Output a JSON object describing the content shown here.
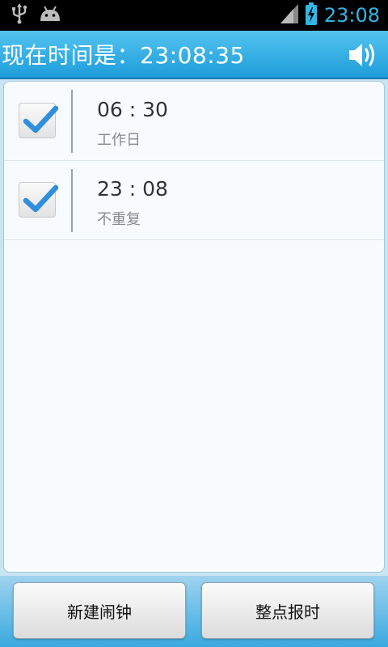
{
  "status_bar": {
    "time": "23:08",
    "time_color": "#33b5e5",
    "icons": [
      "usb-icon",
      "android-debug-icon",
      "signal-icon",
      "battery-charging-icon"
    ]
  },
  "header": {
    "title": "现在时间是：23:08:35",
    "sound_icon": "speaker-icon",
    "bg_color": "#2aa6de"
  },
  "alarms": [
    {
      "time": "06 : 30",
      "repeat": "工作日",
      "enabled": true
    },
    {
      "time": "23 : 08",
      "repeat": "不重复",
      "enabled": true
    }
  ],
  "bottom_buttons": {
    "new_alarm": "新建闹钟",
    "hourly_chime": "整点报时"
  },
  "colors": {
    "accent": "#33b5e5",
    "check": "#2f8fdc"
  }
}
